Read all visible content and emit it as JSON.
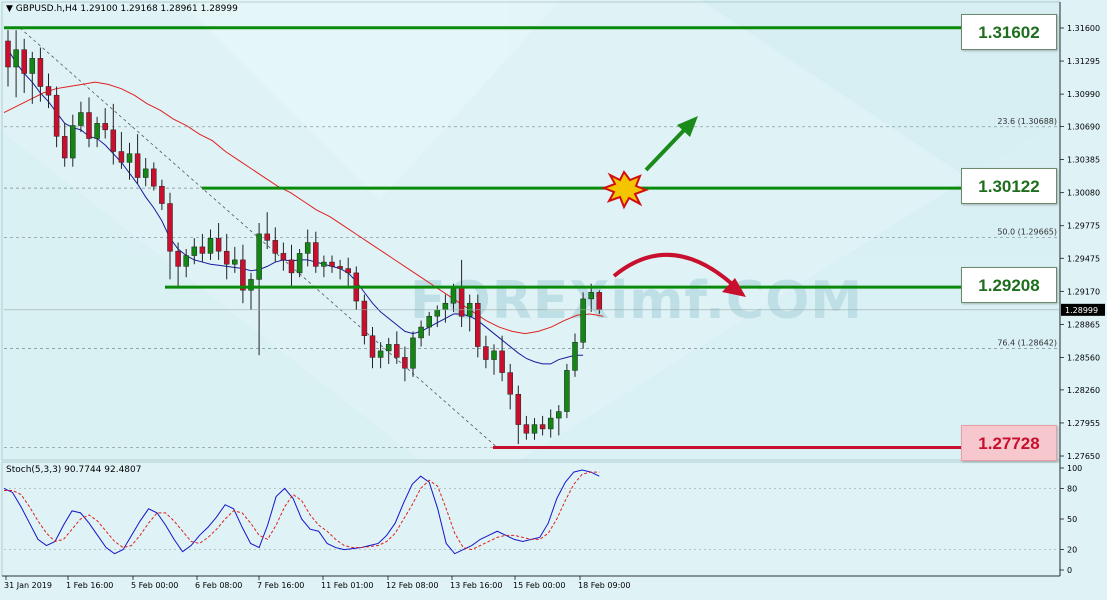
{
  "window": {
    "symbol_info": "GBPUSD.h,H4  1.29100 1.29168 1.28961 1.28999",
    "stoch_info": "Stoch(5,3,3) 90.7744 92.4807"
  },
  "colors": {
    "background": "#dff3f6",
    "bull_candle": "#138613",
    "bear_candle": "#c8102e",
    "level_green": "#0a8a0a",
    "level_red": "#c8102e",
    "ma_fast": "#1a1a9e",
    "ma_slow": "#e02020",
    "stoch_main": "#1515c8",
    "stoch_signal": "#e02020"
  },
  "watermark": "FOREXimf.COM",
  "levels": [
    {
      "label": "1.31602",
      "value": 1.31602,
      "style": "green"
    },
    {
      "label": "1.30122",
      "value": 1.30122,
      "style": "green"
    },
    {
      "label": "1.29208",
      "value": 1.29208,
      "style": "green"
    },
    {
      "label": "1.27728",
      "value": 1.27728,
      "style": "red"
    }
  ],
  "current_price": "1.28999",
  "chart_data": {
    "type": "candlestick",
    "title": "GBPUSD.h,H4  1.29100 1.29168 1.28961 1.28999",
    "ylim": [
      1.2765,
      1.3171
    ],
    "price_ticks": [
      "1.31600",
      "1.31295",
      "1.30990",
      "1.30690",
      "1.30385",
      "1.30080",
      "1.29775",
      "1.29475",
      "1.29170",
      "1.28865",
      "1.28560",
      "1.28260",
      "1.27955",
      "1.27650"
    ],
    "time_labels": [
      "31 Jan 2019",
      "1 Feb 16:00",
      "5 Feb 00:00",
      "6 Feb 08:00",
      "7 Feb 16:00",
      "11 Feb 01:00",
      "12 Feb 08:00",
      "13 Feb 16:00",
      "15 Feb 00:00",
      "18 Feb 09:00"
    ],
    "fibonacci": [
      {
        "label": "23.6 (1.30688)",
        "value": 1.30688
      },
      {
        "label": "50.0 (1.29665)",
        "value": 1.29665
      },
      {
        "label": "76.4 (1.28642)",
        "value": 1.28642
      }
    ],
    "candles_ohlc": [
      [
        1.3148,
        1.3158,
        1.3106,
        1.3124
      ],
      [
        1.3124,
        1.3158,
        1.3096,
        1.314
      ],
      [
        1.314,
        1.315,
        1.31,
        1.3118
      ],
      [
        1.3118,
        1.3138,
        1.309,
        1.3132
      ],
      [
        1.3132,
        1.3142,
        1.3092,
        1.3106
      ],
      [
        1.3106,
        1.3118,
        1.3086,
        1.3098
      ],
      [
        1.3098,
        1.3106,
        1.305,
        1.306
      ],
      [
        1.306,
        1.3072,
        1.3032,
        1.304
      ],
      [
        1.304,
        1.308,
        1.3032,
        1.307
      ],
      [
        1.307,
        1.3092,
        1.3064,
        1.3082
      ],
      [
        1.3082,
        1.3096,
        1.305,
        1.3058
      ],
      [
        1.3058,
        1.3078,
        1.305,
        1.3072
      ],
      [
        1.3072,
        1.3086,
        1.3058,
        1.3066
      ],
      [
        1.3066,
        1.309,
        1.3034,
        1.3046
      ],
      [
        1.3046,
        1.3064,
        1.303,
        1.3036
      ],
      [
        1.3036,
        1.3054,
        1.302,
        1.3044
      ],
      [
        1.3044,
        1.3062,
        1.3016,
        1.3022
      ],
      [
        1.3022,
        1.304,
        1.3014,
        1.303
      ],
      [
        1.303,
        1.3036,
        1.301,
        1.3014
      ],
      [
        1.3014,
        1.302,
        1.2992,
        1.2998
      ],
      [
        1.2998,
        1.3008,
        1.2928,
        1.2954
      ],
      [
        1.2954,
        1.2962,
        1.292,
        1.294
      ],
      [
        1.294,
        1.2956,
        1.293,
        1.295
      ],
      [
        1.295,
        1.2966,
        1.2942,
        1.2958
      ],
      [
        1.2958,
        1.297,
        1.2944,
        1.2952
      ],
      [
        1.2952,
        1.2974,
        1.2946,
        1.2966
      ],
      [
        1.2966,
        1.298,
        1.2946,
        1.2954
      ],
      [
        1.2954,
        1.297,
        1.2928,
        1.2942
      ],
      [
        1.2942,
        1.2958,
        1.2934,
        1.2946
      ],
      [
        1.2946,
        1.296,
        1.2906,
        1.2918
      ],
      [
        1.2918,
        1.2934,
        1.29,
        1.2928
      ],
      [
        1.2928,
        1.298,
        1.2858,
        1.297
      ],
      [
        1.297,
        1.299,
        1.2956,
        1.2964
      ],
      [
        1.2964,
        1.2976,
        1.2944,
        1.2952
      ],
      [
        1.2952,
        1.2962,
        1.2936,
        1.2946
      ],
      [
        1.2946,
        1.296,
        1.292,
        1.2934
      ],
      [
        1.2934,
        1.2956,
        1.293,
        1.2952
      ],
      [
        1.2952,
        1.2974,
        1.294,
        1.2962
      ],
      [
        1.2962,
        1.2972,
        1.2934,
        1.294
      ],
      [
        1.294,
        1.295,
        1.293,
        1.2944
      ],
      [
        1.2944,
        1.295,
        1.2934,
        1.294
      ],
      [
        1.294,
        1.2946,
        1.2928,
        1.2938
      ],
      [
        1.2938,
        1.2948,
        1.292,
        1.2934
      ],
      [
        1.2934,
        1.294,
        1.29,
        1.2908
      ],
      [
        1.2908,
        1.2914,
        1.2868,
        1.2876
      ],
      [
        1.2876,
        1.2884,
        1.2846,
        1.2856
      ],
      [
        1.2856,
        1.287,
        1.2846,
        1.2862
      ],
      [
        1.2862,
        1.2874,
        1.285,
        1.2868
      ],
      [
        1.2868,
        1.288,
        1.285,
        1.2856
      ],
      [
        1.2856,
        1.2866,
        1.2834,
        1.2846
      ],
      [
        1.2846,
        1.288,
        1.2838,
        1.2874
      ],
      [
        1.2874,
        1.289,
        1.2866,
        1.2884
      ],
      [
        1.2884,
        1.2898,
        1.2876,
        1.2894
      ],
      [
        1.2894,
        1.2904,
        1.2884,
        1.29
      ],
      [
        1.29,
        1.2914,
        1.2888,
        1.2906
      ],
      [
        1.2906,
        1.2924,
        1.2898,
        1.292
      ],
      [
        1.292,
        1.2946,
        1.2884,
        1.2894
      ],
      [
        1.2894,
        1.2914,
        1.288,
        1.2906
      ],
      [
        1.2906,
        1.2914,
        1.2856,
        1.2866
      ],
      [
        1.2866,
        1.2876,
        1.2846,
        1.2854
      ],
      [
        1.2854,
        1.2868,
        1.284,
        1.2862
      ],
      [
        1.2862,
        1.2876,
        1.2834,
        1.2842
      ],
      [
        1.2842,
        1.285,
        1.2808,
        1.2822
      ],
      [
        1.2822,
        1.283,
        1.2776,
        1.2794
      ],
      [
        1.2794,
        1.2802,
        1.278,
        1.2786
      ],
      [
        1.2786,
        1.28,
        1.278,
        1.2794
      ],
      [
        1.2794,
        1.2802,
        1.2784,
        1.279
      ],
      [
        1.279,
        1.2808,
        1.2782,
        1.28
      ],
      [
        1.28,
        1.2812,
        1.2784,
        1.2806
      ],
      [
        1.2806,
        1.285,
        1.28,
        1.2844
      ],
      [
        1.2844,
        1.2878,
        1.2838,
        1.287
      ],
      [
        1.287,
        1.2916,
        1.2864,
        1.291
      ],
      [
        1.291,
        1.2924,
        1.2898,
        1.2916
      ],
      [
        1.2916,
        1.2918,
        1.2896,
        1.29
      ]
    ],
    "ma_fast": [
      1.314,
      1.3128,
      1.3118,
      1.311,
      1.31,
      1.3092,
      1.3082,
      1.3072,
      1.3068,
      1.3066,
      1.306,
      1.3058,
      1.3052,
      1.3044,
      1.3036,
      1.3026,
      1.3016,
      1.3004,
      1.2994,
      1.2982,
      1.2966,
      1.2956,
      1.295,
      1.2946,
      1.2944,
      1.2942,
      1.2941,
      1.294,
      1.2939,
      1.2938,
      1.2936,
      1.2937,
      1.294,
      1.2944,
      1.2946,
      1.2945,
      1.2946,
      1.2946,
      1.2944,
      1.2942,
      1.294,
      1.2938,
      1.2934,
      1.2926,
      1.2916,
      1.2906,
      1.2898,
      1.2892,
      1.2886,
      1.288,
      1.2878,
      1.288,
      1.2884,
      1.2888,
      1.2892,
      1.2896,
      1.2896,
      1.2894,
      1.289,
      1.2884,
      1.2878,
      1.2872,
      1.2866,
      1.286,
      1.2855,
      1.2852,
      1.285,
      1.285,
      1.2854,
      1.2856,
      1.2858,
      1.2858
    ],
    "ma_slow": [
      1.3082,
      1.3088,
      1.3094,
      1.31,
      1.3104,
      1.3106,
      1.3108,
      1.311,
      1.3108,
      1.3104,
      1.3098,
      1.309,
      1.3084,
      1.3076,
      1.307,
      1.3062,
      1.3056,
      1.3046,
      1.3038,
      1.303,
      1.3022,
      1.3014,
      1.3008,
      1.3,
      1.2992,
      1.2986,
      1.2978,
      1.297,
      1.2962,
      1.2954,
      1.2946,
      1.2938,
      1.293,
      1.2922,
      1.2914,
      1.2906,
      1.2898,
      1.289,
      1.2884,
      1.288,
      1.2878,
      1.288,
      1.2884,
      1.289,
      1.2895,
      1.2896,
      1.2894
    ],
    "stoch_main": [
      80,
      76,
      62,
      46,
      30,
      24,
      28,
      44,
      58,
      56,
      46,
      34,
      22,
      16,
      20,
      34,
      48,
      60,
      56,
      44,
      30,
      18,
      24,
      34,
      42,
      52,
      64,
      60,
      42,
      26,
      22,
      44,
      72,
      80,
      70,
      50,
      40,
      38,
      26,
      22,
      20,
      21,
      22,
      24,
      26,
      34,
      46,
      66,
      84,
      92,
      86,
      60,
      26,
      16,
      20,
      24,
      30,
      34,
      38,
      34,
      30,
      28,
      30,
      32,
      46,
      70,
      86,
      96,
      98,
      96,
      92
    ],
    "stoch_signal": [
      78,
      78,
      74,
      62,
      48,
      36,
      28,
      30,
      40,
      50,
      54,
      48,
      38,
      28,
      22,
      24,
      34,
      46,
      56,
      56,
      48,
      38,
      28,
      26,
      32,
      40,
      50,
      58,
      56,
      46,
      34,
      30,
      44,
      62,
      74,
      68,
      54,
      44,
      38,
      30,
      24,
      22,
      22,
      23,
      24,
      28,
      36,
      50,
      64,
      80,
      88,
      82,
      60,
      36,
      22,
      20,
      24,
      28,
      32,
      34,
      34,
      32,
      30,
      30,
      36,
      50,
      68,
      84,
      94,
      96,
      96
    ],
    "stoch_ticks": [
      "100",
      "80",
      "50",
      "20",
      "0"
    ]
  },
  "annotations": {
    "arrow_up": "green arrow up",
    "arrow_curve": "red curved arrow",
    "burst": "explosion"
  }
}
